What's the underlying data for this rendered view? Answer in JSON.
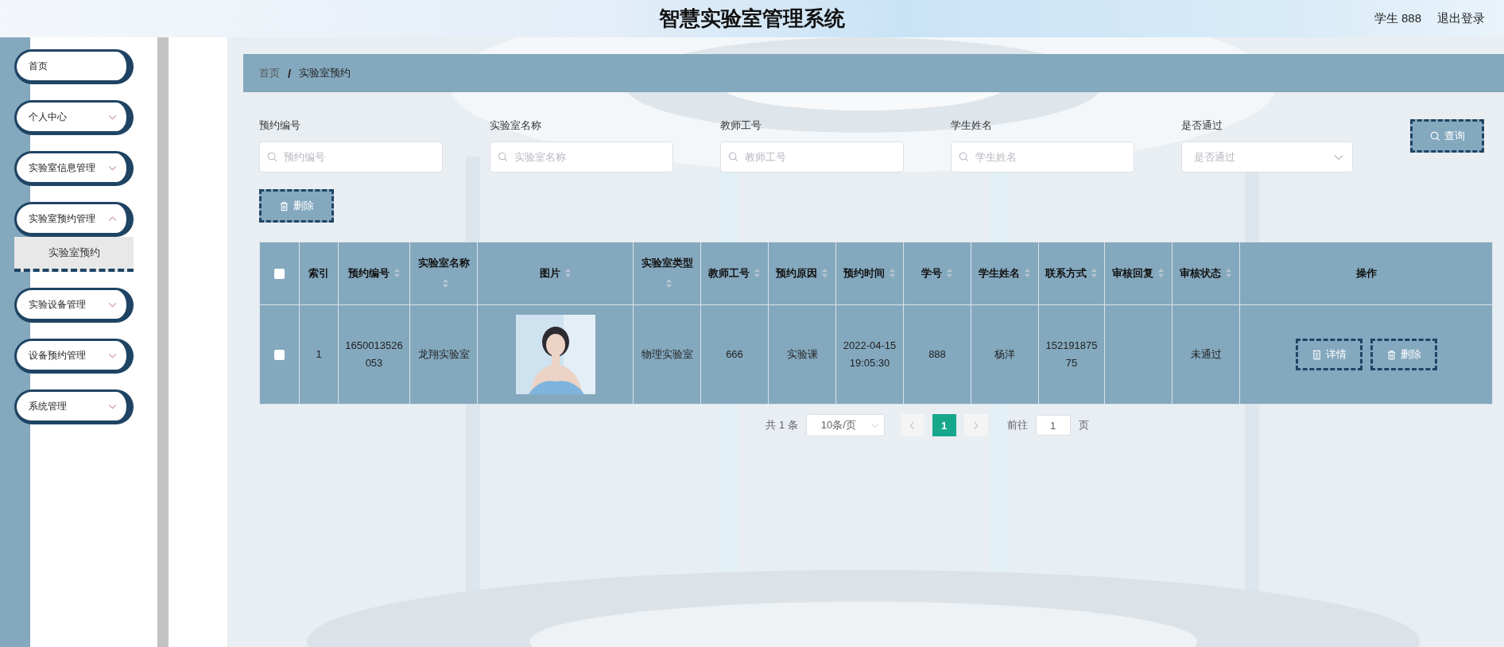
{
  "header": {
    "title": "智慧实验室管理系统",
    "user": "学生 888",
    "logout": "退出登录"
  },
  "sidebar": {
    "items": [
      {
        "label": "首页",
        "kind": "link"
      },
      {
        "label": "个人中心",
        "kind": "submenu"
      },
      {
        "label": "实验室信息管理",
        "kind": "submenu"
      },
      {
        "label": "实验室预约管理",
        "kind": "submenu",
        "expanded": true,
        "children": [
          {
            "label": "实验室预约",
            "selected": true
          }
        ]
      },
      {
        "label": "实验设备管理",
        "kind": "submenu"
      },
      {
        "label": "设备预约管理",
        "kind": "submenu"
      },
      {
        "label": "系统管理",
        "kind": "submenu"
      }
    ]
  },
  "breadcrumb": {
    "items": [
      "首页",
      "实验室预约"
    ],
    "separator": "/"
  },
  "filters": [
    {
      "label": "预约编号",
      "placeholder": "预约编号",
      "kind": "search"
    },
    {
      "label": "实验室名称",
      "placeholder": "实验室名称",
      "kind": "search"
    },
    {
      "label": "教师工号",
      "placeholder": "教师工号",
      "kind": "search"
    },
    {
      "label": "学生姓名",
      "placeholder": "学生姓名",
      "kind": "search"
    },
    {
      "label": "是否通过",
      "placeholder": "是否通过",
      "kind": "select"
    }
  ],
  "search_button": "查询",
  "delete_button": "删除",
  "table": {
    "columns": [
      {
        "kind": "checkbox",
        "checked": false
      },
      {
        "kind": "text",
        "label": "索引",
        "sortable": false
      },
      {
        "kind": "text",
        "label": "预约编号",
        "sortable": true
      },
      {
        "kind": "text",
        "label": "实验室名称",
        "sortable": true
      },
      {
        "kind": "picture",
        "label": "图片",
        "sortable": true
      },
      {
        "kind": "text",
        "label": "实验室类型",
        "sortable": true
      },
      {
        "kind": "text",
        "label": "教师工号",
        "sortable": true
      },
      {
        "kind": "text",
        "label": "预约原因",
        "sortable": true
      },
      {
        "kind": "text",
        "label": "预约时间",
        "sortable": true
      },
      {
        "kind": "text",
        "label": "学号",
        "sortable": true
      },
      {
        "kind": "text",
        "label": "学生姓名",
        "sortable": true
      },
      {
        "kind": "text",
        "label": "联系方式",
        "sortable": true
      },
      {
        "kind": "text",
        "label": "审核回复",
        "sortable": true
      },
      {
        "kind": "text",
        "label": "审核状态",
        "sortable": true
      },
      {
        "kind": "actions",
        "label": "操作",
        "sortable": false
      }
    ],
    "rows": [
      {
        "cells": [
          {
            "checked": false
          },
          {
            "text": "1"
          },
          {
            "text": "1650013526053"
          },
          {
            "text": "龙翔实验室"
          },
          {
            "kind": "picture"
          },
          {
            "text": "物理实验室"
          },
          {
            "text": "666"
          },
          {
            "text": "实验课"
          },
          {
            "text": "2022-04-15 19:05:30"
          },
          {
            "text": "888"
          },
          {
            "text": "杨洋"
          },
          {
            "text": "15219187575"
          },
          {},
          {
            "text": "未通过"
          },
          {
            "actions": [
              {
                "label": "详情",
                "kind": "detail"
              },
              {
                "label": "删除",
                "kind": "delete"
              }
            ]
          }
        ]
      }
    ]
  },
  "pagination": {
    "total": "共 1 条",
    "page_size": "10条/页",
    "prev_disabled": true,
    "next_disabled": true,
    "pages": [
      {
        "label": "1",
        "selected": true
      }
    ],
    "goto_label": "前往",
    "goto_value": "1",
    "goto_suffix": "页"
  }
}
